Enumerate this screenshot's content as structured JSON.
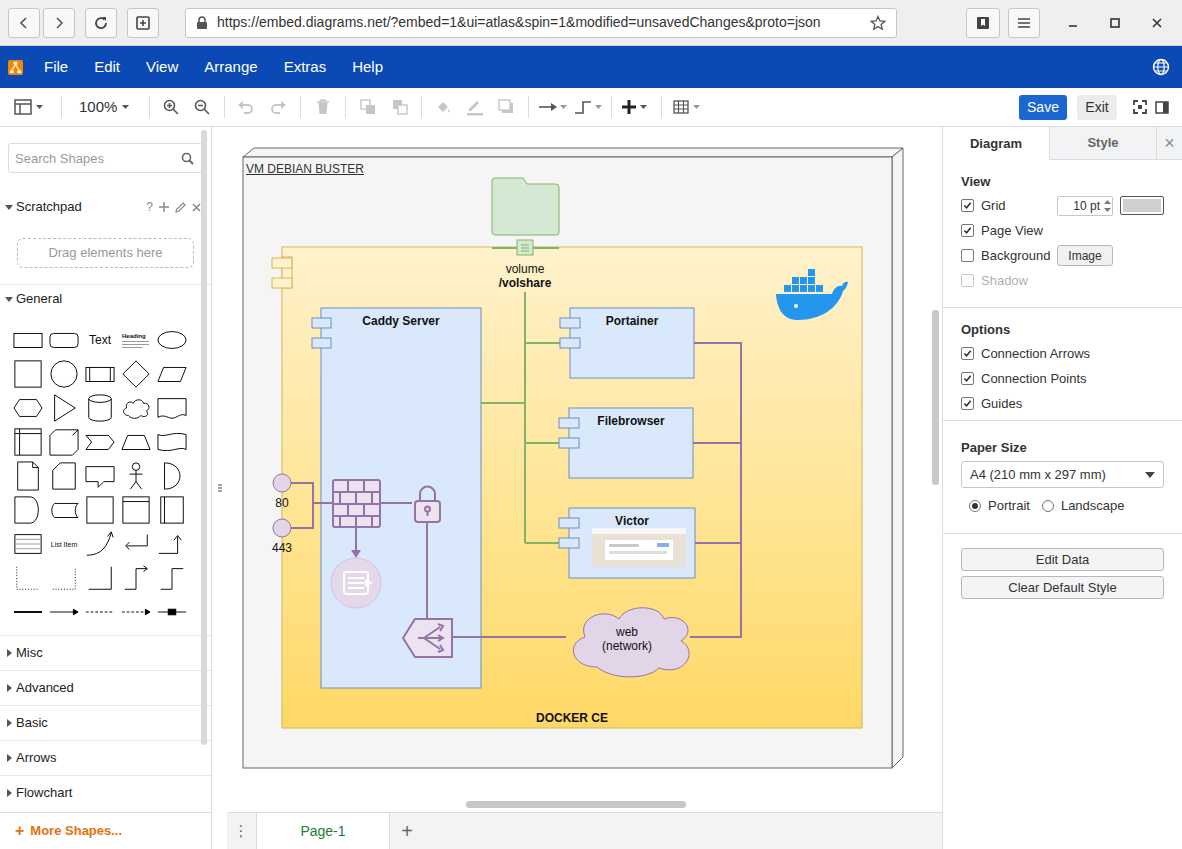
{
  "browser": {
    "url": "https://embed.diagrams.net/?embed=1&ui=atlas&spin=1&modified=unsavedChanges&proto=json"
  },
  "menu_bar": {
    "items": [
      "File",
      "Edit",
      "View",
      "Arrange",
      "Extras",
      "Help"
    ]
  },
  "toolbar": {
    "zoom": "100%",
    "zoom_in": {
      "disabled": false
    },
    "zoom_out": {
      "disabled": false
    },
    "undo": {
      "disabled": true
    },
    "redo": {
      "disabled": true
    },
    "delete": {
      "disabled": true
    },
    "to_front": {
      "disabled": true
    },
    "to_back": {
      "disabled": true
    },
    "fill_color": {
      "disabled": true
    },
    "line_color": {
      "disabled": true
    },
    "shadow": {
      "disabled": true
    },
    "save": "Save",
    "exit": "Exit"
  },
  "sidebar": {
    "search": {
      "placeholder": "Search Shapes"
    },
    "scratchpad": {
      "title": "Scratchpad",
      "expanded": true,
      "help": "?",
      "drop_hint": "Drag elements here"
    },
    "sections": [
      {
        "title": "General",
        "expanded": true
      },
      {
        "title": "Misc",
        "expanded": false
      },
      {
        "title": "Advanced",
        "expanded": false
      },
      {
        "title": "Basic",
        "expanded": false
      },
      {
        "title": "Arrows",
        "expanded": false
      },
      {
        "title": "Flowchart",
        "expanded": false
      }
    ],
    "shape_labels": {
      "text": "Text",
      "heading": "Heading",
      "list_item": "List Item"
    },
    "more_shapes": {
      "icon": "+",
      "label": "More Shapes..."
    }
  },
  "diagram": {
    "vm": {
      "label": "VM DEBIAN BUSTER"
    },
    "docker": {
      "label": "DOCKER CE"
    },
    "volume": {
      "label": "volume",
      "path": "/volshare"
    },
    "services": [
      {
        "name": "Caddy Server"
      },
      {
        "name": "Portainer"
      },
      {
        "name": "Filebrowser"
      },
      {
        "name": "Victor"
      }
    ],
    "ports": [
      {
        "label": "80"
      },
      {
        "label": "443"
      }
    ],
    "network": {
      "label": "web",
      "sublabel": "(network)"
    }
  },
  "format_panel": {
    "tabs": [
      {
        "label": "Diagram",
        "selected": true
      },
      {
        "label": "Style",
        "selected": false
      }
    ],
    "close": "×",
    "view": {
      "title": "View",
      "options": [
        {
          "label": "Grid",
          "checked": true,
          "disabled": false
        },
        {
          "label": "Page View",
          "checked": true,
          "disabled": false
        },
        {
          "label": "Background",
          "checked": false,
          "disabled": false
        },
        {
          "label": "Shadow",
          "checked": false,
          "disabled": true
        }
      ],
      "grid_size": "10 pt",
      "background_button": "Image"
    },
    "options": {
      "title": "Options",
      "items": [
        {
          "label": "Connection Arrows",
          "checked": true
        },
        {
          "label": "Connection Points",
          "checked": true
        },
        {
          "label": "Guides",
          "checked": true
        }
      ]
    },
    "paper": {
      "title": "Paper Size",
      "size": "A4 (210 mm x 297 mm)",
      "orientation": [
        {
          "label": "Portrait",
          "selected": true
        },
        {
          "label": "Landscape",
          "selected": false
        }
      ]
    },
    "buttons": [
      "Edit Data",
      "Clear Default Style"
    ]
  },
  "pages": {
    "menu": "⋮",
    "tabs": [
      {
        "label": "Page-1",
        "selected": true
      }
    ],
    "add": "+"
  }
}
